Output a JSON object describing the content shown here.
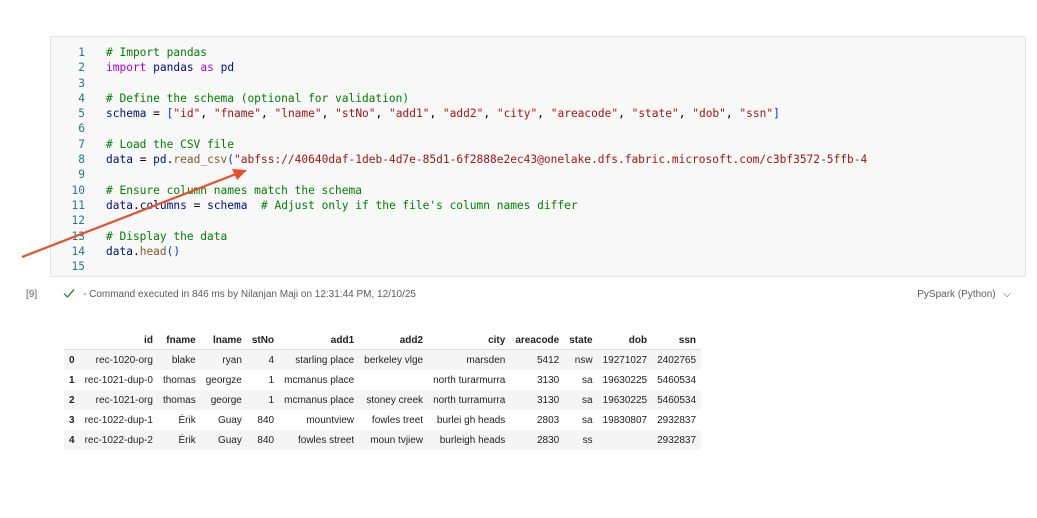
{
  "cell": {
    "lines": [
      {
        "n": "1",
        "tokens": [
          {
            "t": "c",
            "v": "# Import pandas"
          }
        ]
      },
      {
        "n": "2",
        "tokens": [
          {
            "t": "k",
            "v": "import"
          },
          {
            "t": "o",
            "v": " "
          },
          {
            "t": "n",
            "v": "pandas"
          },
          {
            "t": "o",
            "v": " "
          },
          {
            "t": "k",
            "v": "as"
          },
          {
            "t": "o",
            "v": " "
          },
          {
            "t": "n",
            "v": "pd"
          }
        ]
      },
      {
        "n": "3",
        "tokens": []
      },
      {
        "n": "4",
        "tokens": [
          {
            "t": "c",
            "v": "# Define the schema (optional for validation)"
          }
        ]
      },
      {
        "n": "5",
        "tokens": [
          {
            "t": "n",
            "v": "schema"
          },
          {
            "t": "o",
            "v": " = "
          },
          {
            "t": "p",
            "v": "["
          },
          {
            "t": "s",
            "v": "\"id\""
          },
          {
            "t": "o",
            "v": ", "
          },
          {
            "t": "s",
            "v": "\"fname\""
          },
          {
            "t": "o",
            "v": ", "
          },
          {
            "t": "s",
            "v": "\"lname\""
          },
          {
            "t": "o",
            "v": ", "
          },
          {
            "t": "s",
            "v": "\"stNo\""
          },
          {
            "t": "o",
            "v": ", "
          },
          {
            "t": "s",
            "v": "\"add1\""
          },
          {
            "t": "o",
            "v": ", "
          },
          {
            "t": "s",
            "v": "\"add2\""
          },
          {
            "t": "o",
            "v": ", "
          },
          {
            "t": "s",
            "v": "\"city\""
          },
          {
            "t": "o",
            "v": ", "
          },
          {
            "t": "s",
            "v": "\"areacode\""
          },
          {
            "t": "o",
            "v": ", "
          },
          {
            "t": "s",
            "v": "\"state\""
          },
          {
            "t": "o",
            "v": ", "
          },
          {
            "t": "s",
            "v": "\"dob\""
          },
          {
            "t": "o",
            "v": ", "
          },
          {
            "t": "s",
            "v": "\"ssn\""
          },
          {
            "t": "p",
            "v": "]"
          }
        ]
      },
      {
        "n": "6",
        "tokens": []
      },
      {
        "n": "7",
        "tokens": [
          {
            "t": "c",
            "v": "# Load the CSV file"
          }
        ]
      },
      {
        "n": "8",
        "tokens": [
          {
            "t": "n",
            "v": "data"
          },
          {
            "t": "o",
            "v": " = "
          },
          {
            "t": "n",
            "v": "pd"
          },
          {
            "t": "o",
            "v": "."
          },
          {
            "t": "f",
            "v": "read_csv"
          },
          {
            "t": "p",
            "v": "("
          },
          {
            "t": "s",
            "v": "\"abfss://40640daf-1deb-4d7e-85d1-6f2888e2ec43@onelake.dfs.fabric.microsoft.com/c3bf3572-5ffb-4"
          }
        ]
      },
      {
        "n": "9",
        "tokens": []
      },
      {
        "n": "10",
        "tokens": [
          {
            "t": "c",
            "v": "# Ensure column names match the schema"
          }
        ]
      },
      {
        "n": "11",
        "tokens": [
          {
            "t": "n",
            "v": "data"
          },
          {
            "t": "o",
            "v": "."
          },
          {
            "t": "n",
            "v": "columns"
          },
          {
            "t": "o",
            "v": " = "
          },
          {
            "t": "n",
            "v": "schema"
          },
          {
            "t": "o",
            "v": "  "
          },
          {
            "t": "c",
            "v": "# Adjust only if the file's column names differ"
          }
        ]
      },
      {
        "n": "12",
        "tokens": []
      },
      {
        "n": "13",
        "tokens": [
          {
            "t": "c",
            "v": "# Display the data"
          }
        ]
      },
      {
        "n": "14",
        "tokens": [
          {
            "t": "n",
            "v": "data"
          },
          {
            "t": "o",
            "v": "."
          },
          {
            "t": "f",
            "v": "head"
          },
          {
            "t": "p",
            "v": "()"
          }
        ]
      },
      {
        "n": "15",
        "tokens": []
      }
    ]
  },
  "status": {
    "exec_count": "[9]",
    "exec_text": "- Command executed in 846 ms by Nilanjan Maji on 12:31:44 PM, 12/10/25",
    "kernel": "PySpark (Python)"
  },
  "table": {
    "columns": [
      "id",
      "fname",
      "lname",
      "stNo",
      "add1",
      "add2",
      "city",
      "areacode",
      "state",
      "dob",
      "ssn"
    ],
    "rows": [
      {
        "index": "0",
        "cells": [
          "rec-1020-org",
          "blake",
          "ryan",
          "4",
          "starling place",
          "berkeley vlge",
          "marsden",
          "5412",
          "nsw",
          "19271027",
          "2402765"
        ]
      },
      {
        "index": "1",
        "cells": [
          "rec-1021-dup-0",
          "thomas",
          "georgze",
          "1",
          "mcmanus place",
          "",
          "north turarmurra",
          "3130",
          "sa",
          "19630225",
          "5460534"
        ]
      },
      {
        "index": "2",
        "cells": [
          "rec-1021-org",
          "thomas",
          "george",
          "1",
          "mcmanus place",
          "stoney creek",
          "north turramurra",
          "3130",
          "sa",
          "19630225",
          "5460534"
        ]
      },
      {
        "index": "3",
        "cells": [
          "rec-1022-dup-1",
          "Érik",
          "Guay",
          "840",
          "mountview",
          "fowles treet",
          "burlei gh heads",
          "2803",
          "sa",
          "19830807",
          "2932837"
        ]
      },
      {
        "index": "4",
        "cells": [
          "rec-1022-dup-2",
          "Érik",
          "Guay",
          "840",
          "fowles street",
          "moun tvjiew",
          "burleigh heads",
          "2830",
          "ss",
          "",
          "2932837"
        ]
      }
    ]
  },
  "colors": {
    "arrow": "#e8502a",
    "check": "#2e8b3a"
  }
}
